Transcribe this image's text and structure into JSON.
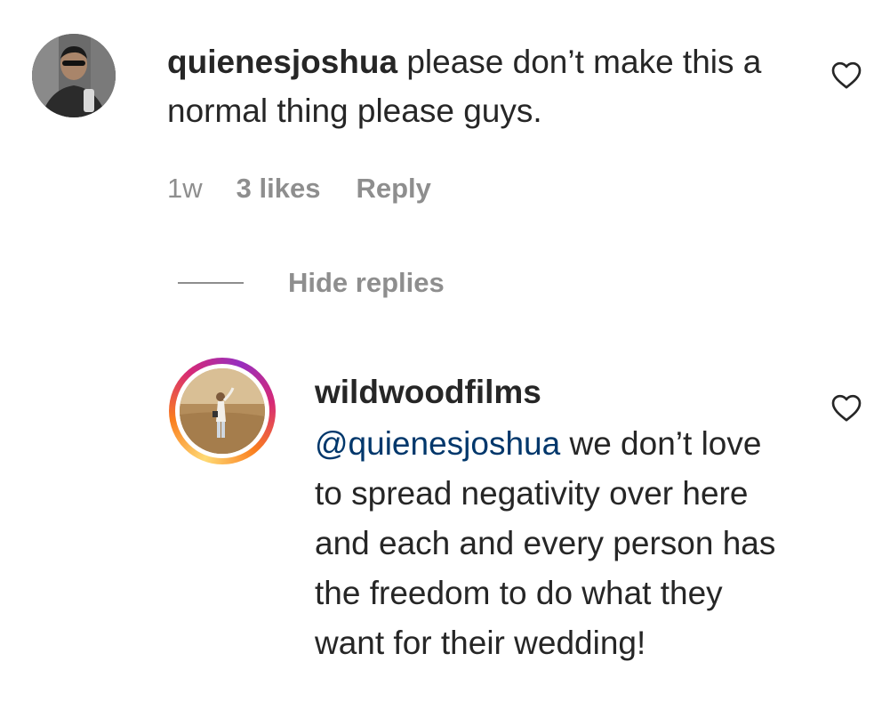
{
  "comment": {
    "username": "quienesjoshua",
    "text": "please don’t make this a normal thing please guys.",
    "time": "1w",
    "likes": "3 likes",
    "reply_label": "Reply",
    "like_icon": "heart-outline-icon"
  },
  "thread": {
    "hide_replies_label": "Hide replies"
  },
  "reply": {
    "username": "wildwoodfilms",
    "mention": "@quienesjoshua",
    "text": "we don’t love to spread negativity over here and each and every person has the freedom to do what they want for their wedding!",
    "like_icon": "heart-outline-icon",
    "avatar_ring_colors": [
      "#feda75",
      "#fa7e1e",
      "#d62976",
      "#962fbf"
    ]
  },
  "colors": {
    "text_primary": "#262626",
    "text_secondary": "#8e8e8e",
    "mention": "#00376b"
  }
}
